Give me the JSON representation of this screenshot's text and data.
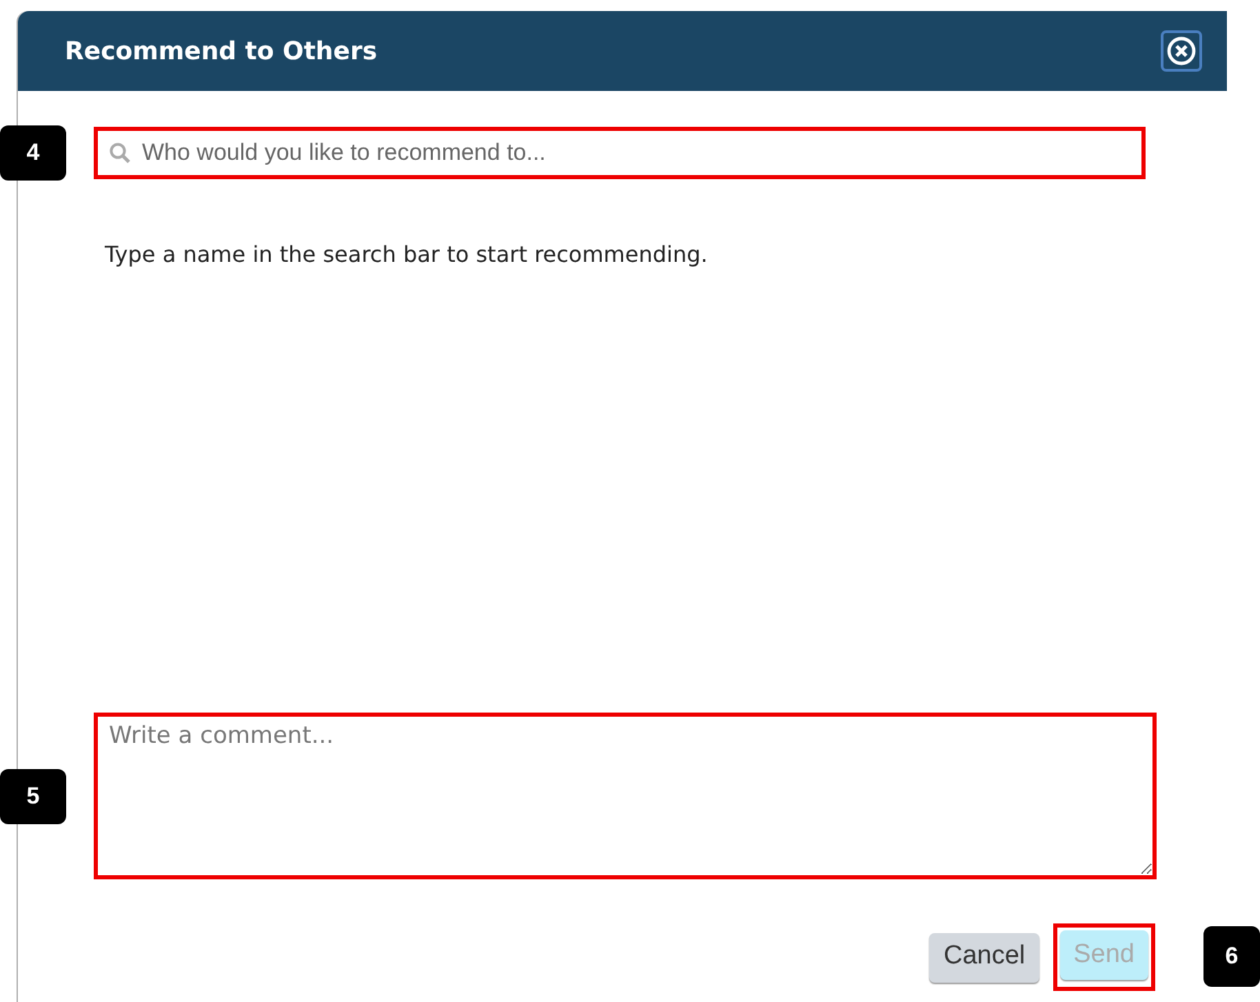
{
  "dialog": {
    "title": "Recommend to Others"
  },
  "search": {
    "placeholder": "Who would you like to recommend to...",
    "highlighted": true,
    "callout": "4"
  },
  "hint": "Type a name in the search bar to start recommending.",
  "comment": {
    "placeholder": "Write a comment...",
    "highlighted": true,
    "callout": "5"
  },
  "buttons": [
    {
      "kind": "cancel",
      "label": "Cancel",
      "disabled": false,
      "highlighted": false
    },
    {
      "kind": "send",
      "label": "Send",
      "disabled": true,
      "highlighted": true,
      "callout": "6"
    }
  ]
}
